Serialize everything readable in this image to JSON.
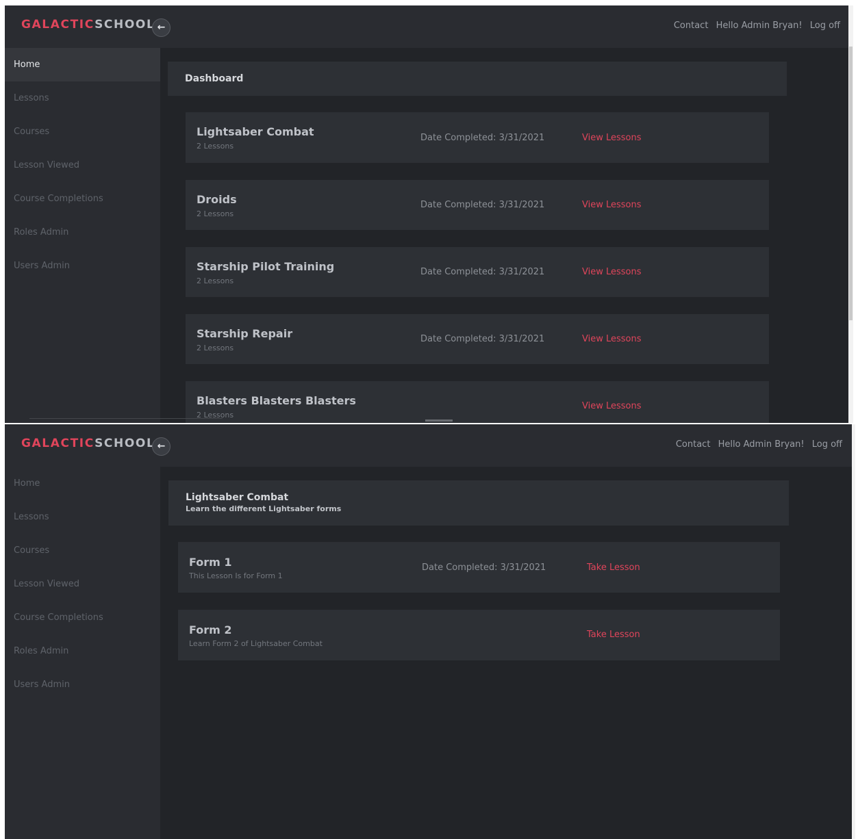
{
  "brand": {
    "accent": "GALACTIC",
    "rest": "SCHOOL",
    "accent_color": "#e0455b"
  },
  "toggle": {
    "icon": "arrow-left-icon",
    "glyph": "←"
  },
  "topnav": {
    "contact": "Contact",
    "greeting": "Hello Admin Bryan!",
    "logoff": "Log off"
  },
  "sidebar": {
    "items": [
      {
        "label": "Home"
      },
      {
        "label": "Lessons"
      },
      {
        "label": "Courses"
      },
      {
        "label": "Lesson Viewed"
      },
      {
        "label": "Course Completions"
      },
      {
        "label": "Roles Admin"
      },
      {
        "label": "Users Admin"
      }
    ]
  },
  "dashboard": {
    "title": "Dashboard",
    "courses": [
      {
        "title": "Lightsaber Combat",
        "lessons": "2 Lessons",
        "date": "Date Completed: 3/31/2021",
        "link": "View Lessons"
      },
      {
        "title": "Droids",
        "lessons": "2 Lessons",
        "date": "Date Completed: 3/31/2021",
        "link": "View Lessons"
      },
      {
        "title": "Starship Pilot Training",
        "lessons": "2 Lessons",
        "date": "Date Completed: 3/31/2021",
        "link": "View Lessons"
      },
      {
        "title": "Starship Repair",
        "lessons": "2 Lessons",
        "date": "Date Completed: 3/31/2021",
        "link": "View Lessons"
      },
      {
        "title": "Blasters Blasters Blasters",
        "lessons": "2 Lessons",
        "date": "",
        "link": "View Lessons"
      }
    ]
  },
  "course_page": {
    "title": "Lightsaber Combat",
    "subtitle": "Learn the different Lightsaber forms",
    "lessons": [
      {
        "title": "Form 1",
        "desc": "This Lesson Is for Form 1",
        "date": "Date Completed: 3/31/2021",
        "link": "Take Lesson"
      },
      {
        "title": "Form 2",
        "desc": "Learn Form 2 of Lightsaber Combat",
        "date": "",
        "link": "Take Lesson"
      }
    ]
  }
}
